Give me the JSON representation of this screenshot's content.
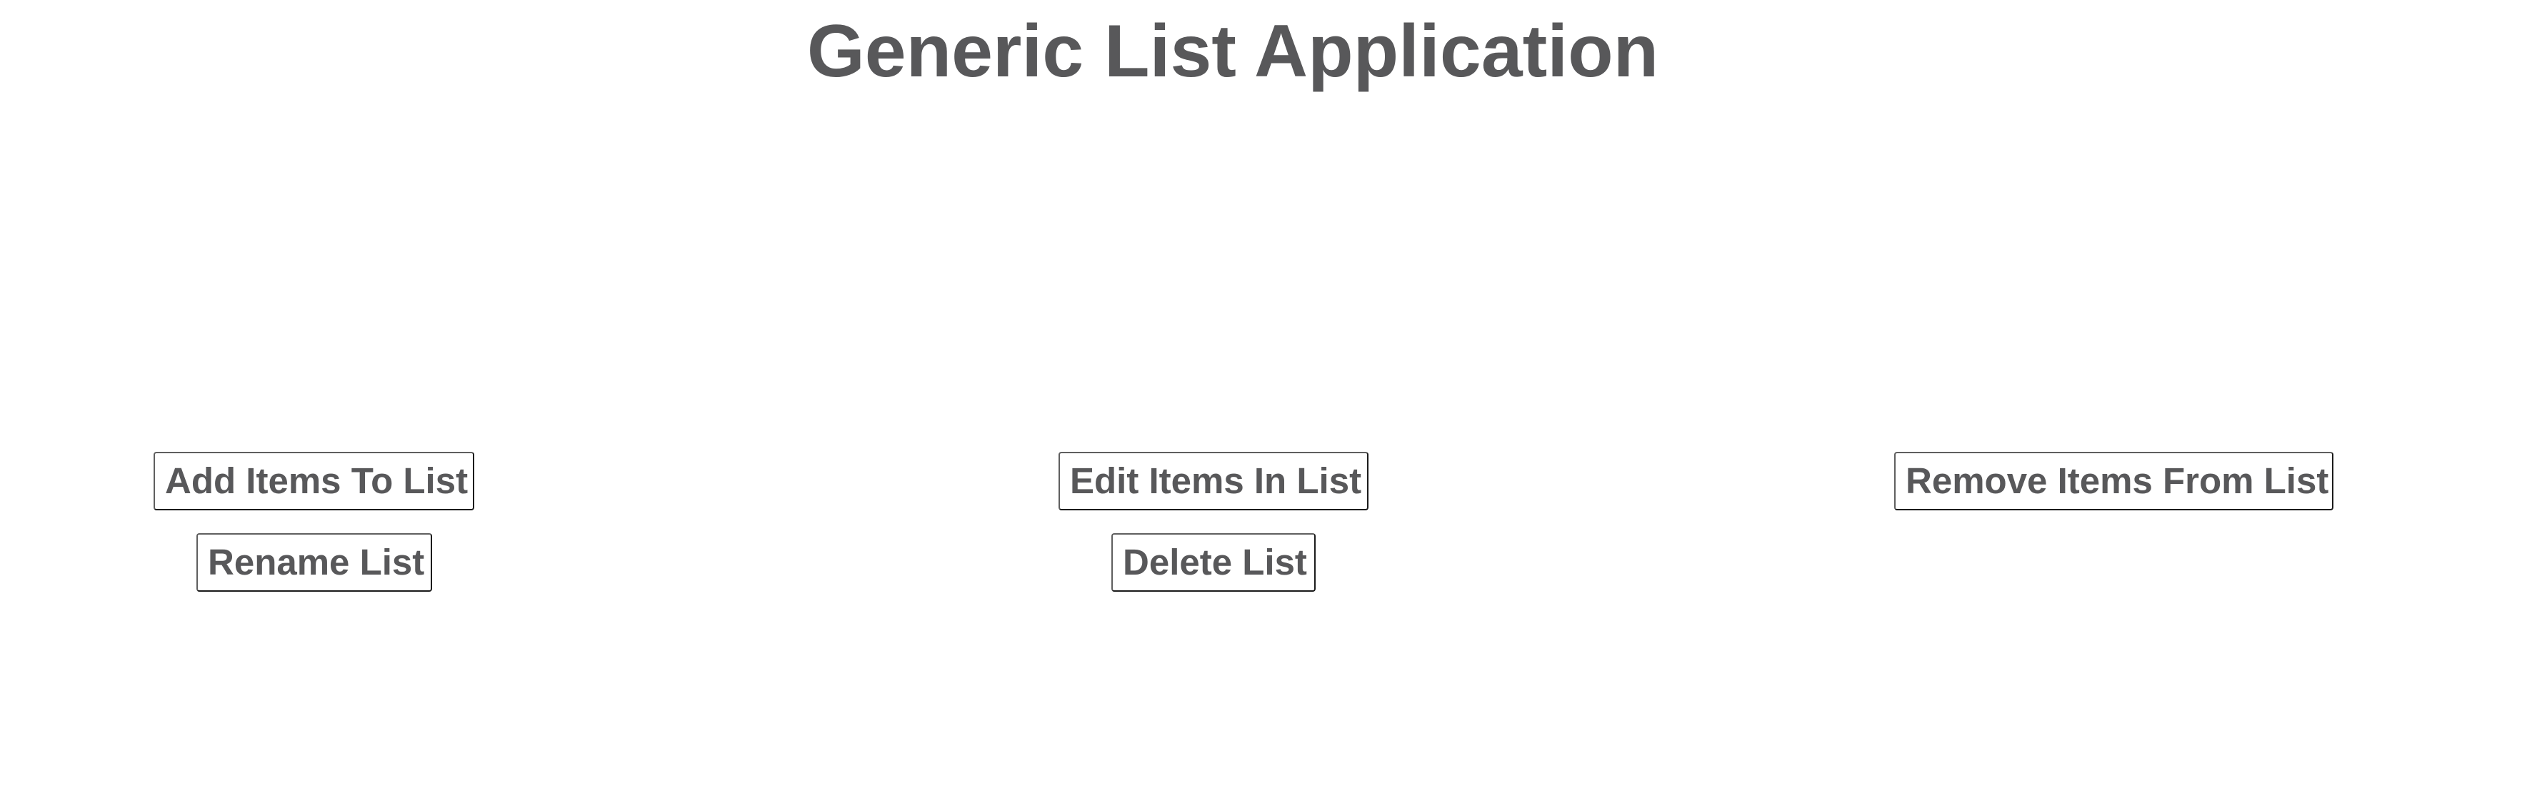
{
  "app": {
    "title": "Generic List Application"
  },
  "actions": {
    "add_label": "Add Items To List",
    "rename_label": "Rename List",
    "edit_label": "Edit Items In List",
    "delete_label": "Delete List",
    "remove_label": "Remove Items From List"
  },
  "colors": {
    "text": "#58585a",
    "background": "#ffffff",
    "button_border_dark": "#1b1b1b"
  }
}
